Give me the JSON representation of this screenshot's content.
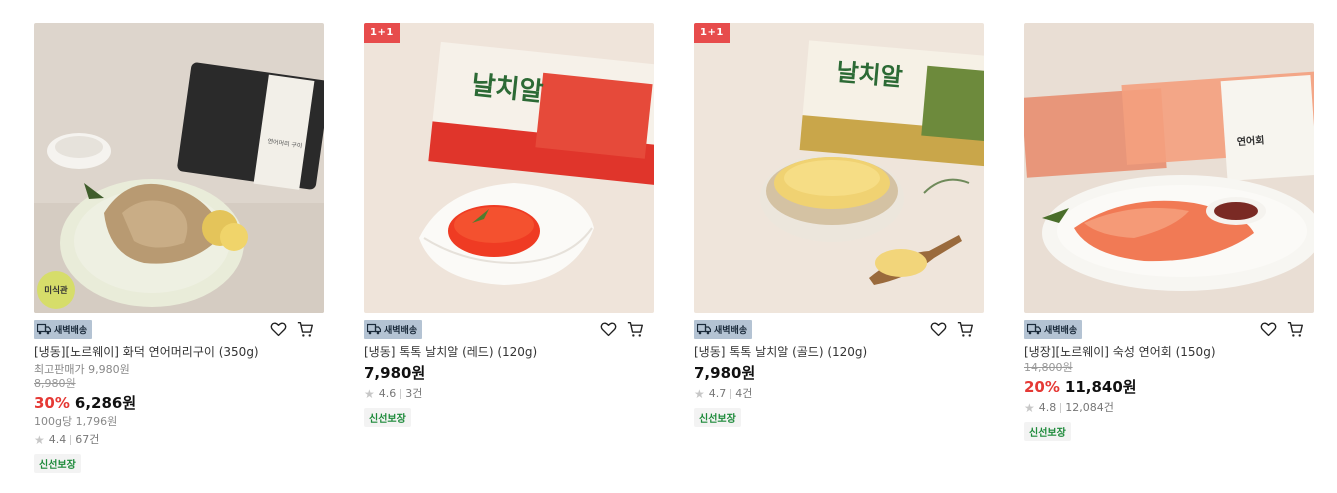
{
  "products": [
    {
      "title": "[냉동][노르웨이] 화덕 연어머리구이 (350g)",
      "promo_badge": "",
      "circle_badge": "미식관",
      "delivery": "새벽배송",
      "ref_price": "최고판매가 9,980원",
      "original_price": "8,980원",
      "discount": "30%",
      "price": "6,286원",
      "unit_price": "100g당 1,796원",
      "rating": "4.4",
      "reviews": "67건",
      "guarantee": "신선보장",
      "image_label": "연어머리 구이"
    },
    {
      "title": "[냉동] 톡톡 날치알 (레드) (120g)",
      "promo_badge": "1+1",
      "delivery": "새벽배송",
      "price": "7,980원",
      "rating": "4.6",
      "reviews": "3건",
      "guarantee": "신선보장",
      "image_label": "날치알"
    },
    {
      "title": "[냉동] 톡톡 날치알 (골드) (120g)",
      "promo_badge": "1+1",
      "delivery": "새벽배송",
      "price": "7,980원",
      "rating": "4.7",
      "reviews": "4건",
      "guarantee": "신선보장",
      "image_label": "날치알"
    },
    {
      "title": "[냉장][노르웨이] 숙성 연어회 (150g)",
      "promo_badge": "",
      "delivery": "새벽배송",
      "original_price": "14,800원",
      "discount": "20%",
      "price": "11,840원",
      "rating": "4.8",
      "reviews": "12,084건",
      "guarantee": "신선보장",
      "image_label": "연어회"
    }
  ],
  "icons": {
    "delivery": "truck-icon",
    "wishlist": "heart-icon",
    "cart": "cart-icon",
    "star": "star-icon"
  },
  "colors": {
    "discount": "#e53935",
    "promo_badge": "#e74c4c",
    "delivery_tag": "#b4c3d3",
    "guarantee_text": "#1d8a3a"
  }
}
